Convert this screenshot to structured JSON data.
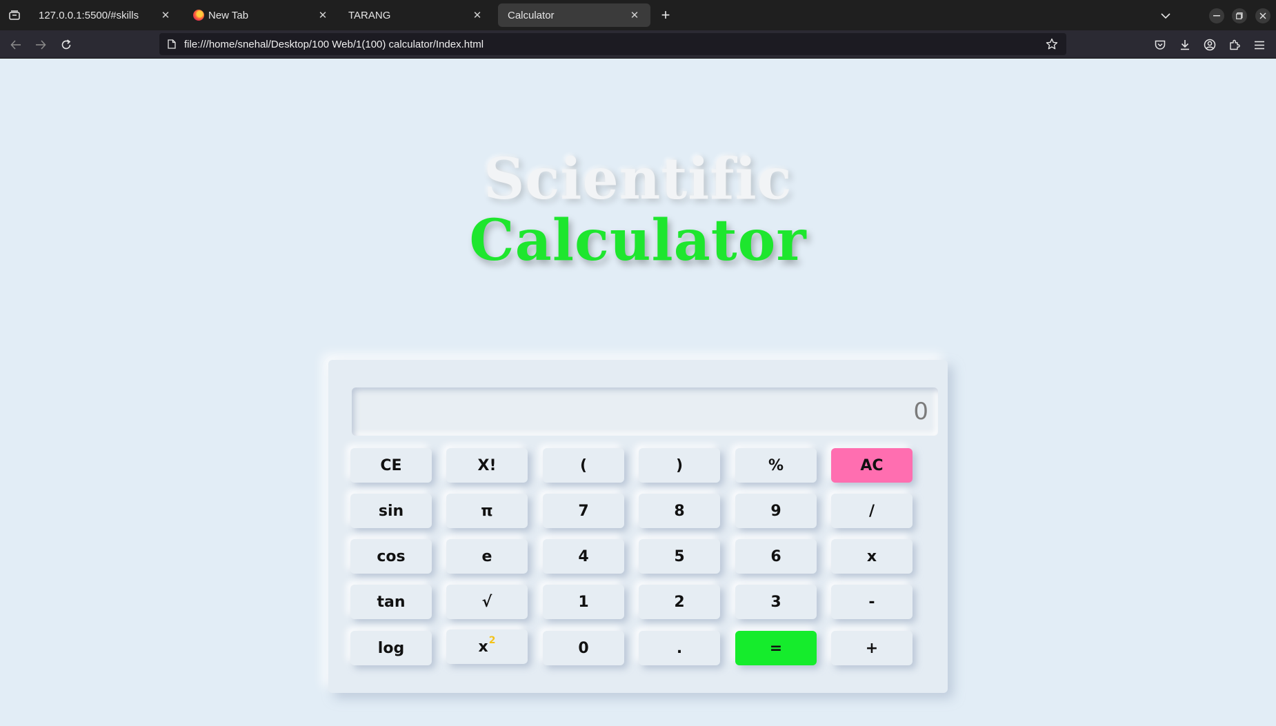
{
  "browser": {
    "tabs": [
      {
        "title": "127.0.0.1:5500/#skills",
        "active": false
      },
      {
        "title": "New Tab",
        "active": false
      },
      {
        "title": "TARANG",
        "active": false
      },
      {
        "title": "Calculator",
        "active": true
      }
    ],
    "url": "file:///home/snehal/Desktop/100 Web/1(100) calculator/Index.html",
    "icons": {
      "tab_list": "tab-list-icon",
      "new_tab": "+",
      "back": "back-arrow-icon",
      "forward": "forward-arrow-icon",
      "reload": "reload-icon",
      "bookmark": "star-icon",
      "pocket": "pocket-icon",
      "downloads": "download-icon",
      "account": "account-icon",
      "extensions": "extensions-icon",
      "menu": "hamburger-icon"
    }
  },
  "page": {
    "heading_line1": "Scientific",
    "heading_line2": "Calculator",
    "display_value": "0",
    "keys": [
      [
        "CE",
        "X!",
        "(",
        ")",
        "%",
        "AC"
      ],
      [
        "sin",
        "π",
        "7",
        "8",
        "9",
        "/"
      ],
      [
        "cos",
        "e",
        "4",
        "5",
        "6",
        "x"
      ],
      [
        "tan",
        "√",
        "1",
        "2",
        "3",
        "-"
      ],
      [
        "log",
        "x",
        "0",
        ".",
        "=",
        "+"
      ]
    ],
    "square_key_superscript": "2"
  },
  "colors": {
    "page_bg": "#e2edf6",
    "heading_green": "#1ee62e",
    "ac_key": "#ff6eb0",
    "equals_key": "#15ec2c",
    "superscript": "#f3c21a"
  }
}
